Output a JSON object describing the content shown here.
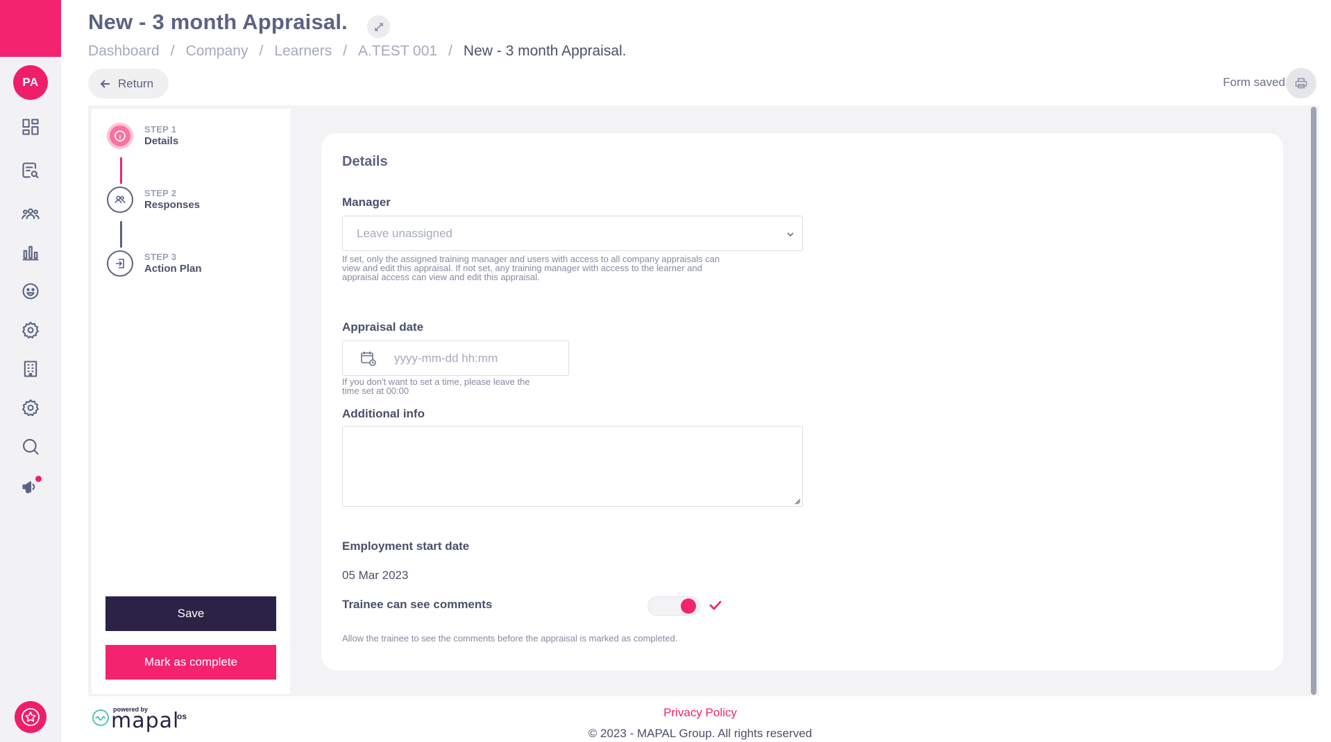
{
  "app": {
    "brand_color": "#f4236f",
    "avatar_initials": "PA"
  },
  "sidebar": {
    "icons": [
      "dashboard-icon",
      "search-document-icon",
      "people-icon",
      "chart-icon",
      "smiley-icon",
      "settings-icon",
      "building-icon",
      "settings-icon-2",
      "search-icon",
      "megaphone-icon"
    ],
    "has_notification": true
  },
  "header": {
    "title": "New - 3 month Appraisal.",
    "breadcrumb": [
      "Dashboard",
      "Company",
      "Learners",
      "A.TEST 001",
      "New - 3 month Appraisal."
    ],
    "return_label": "Return",
    "status": "Form saved"
  },
  "steps": [
    {
      "num": "STEP 1",
      "label": "Details",
      "active": true,
      "icon": "info-icon"
    },
    {
      "num": "STEP 2",
      "label": "Responses",
      "active": false,
      "icon": "people-icon"
    },
    {
      "num": "STEP 3",
      "label": "Action Plan",
      "active": false,
      "icon": "enter-icon"
    }
  ],
  "actions": {
    "save_label": "Save",
    "complete_label": "Mark as complete"
  },
  "form": {
    "title": "Details",
    "manager": {
      "label": "Manager",
      "placeholder": "Leave unassigned",
      "help_lines": [
        "If set, only the assigned training manager and users with access to all company appraisals can",
        "view and edit this appraisal. If not set, any training manager with access to the learner and",
        "appraisal access can view and edit this appraisal."
      ]
    },
    "appraisal_date": {
      "label": "Appraisal date",
      "placeholder": "yyyy-mm-dd hh:mm",
      "help_lines": [
        "If you don't want to set a time, please leave the",
        "time set at 00:00"
      ]
    },
    "additional_info": {
      "label": "Additional info",
      "value": ""
    },
    "employment_start": {
      "label": "Employment start date",
      "value": "05 Mar 2023"
    },
    "trainee_comments": {
      "label": "Trainee can see comments",
      "enabled": true,
      "help": "Allow the trainee to see the comments before the appraisal is marked as completed."
    }
  },
  "footer": {
    "powered_by": "powered by",
    "logo_text": "mapal",
    "logo_suffix": "os",
    "privacy": "Privacy Policy",
    "copyright": "© 2023 - MAPAL Group. All rights reserved"
  }
}
